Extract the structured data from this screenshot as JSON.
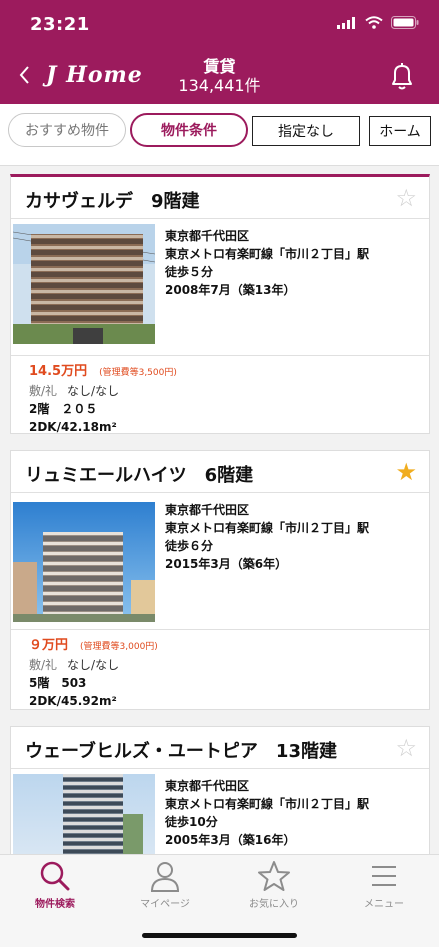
{
  "status": {
    "time": "23:21"
  },
  "header": {
    "logo": "J Home",
    "title": "賃貸",
    "count": "134,441件",
    "brand_color": "#9c1b5d"
  },
  "filters": {
    "recommend": "おすすめ物件",
    "conditions": "物件条件",
    "none": "指定なし",
    "home": "ホーム"
  },
  "listings": [
    {
      "name": "カサヴェルデ　9階建",
      "favorite": false,
      "ward": "東京都千代田区",
      "station": "東京メトロ有楽町線「市川２丁目」駅",
      "walk": "徒歩５分",
      "built": "2008年7月（築13年）",
      "price": "14.5万円",
      "management": "(管理費等3,500円)",
      "deposit_label": "敷/礼",
      "deposit_value": "なし/なし",
      "floor": "2階　２０５",
      "layout": "2DK/42.18m²"
    },
    {
      "name": "リュミエールハイツ　6階建",
      "favorite": true,
      "ward": "東京都千代田区",
      "station": "東京メトロ有楽町線「市川２丁目」駅",
      "walk": "徒歩６分",
      "built": "2015年3月（築6年）",
      "price": "９万円",
      "management": "(管理費等3,000円)",
      "deposit_label": "敷/礼",
      "deposit_value": "なし/なし",
      "floor": "5階　503",
      "layout": "2DK/45.92m²"
    },
    {
      "name": "ウェーブヒルズ・ユートピア　13階建",
      "favorite": false,
      "ward": "東京都千代田区",
      "station": "東京メトロ有楽町線「市川２丁目」駅",
      "walk": "徒歩10分",
      "built": "2005年3月（築16年）"
    }
  ],
  "tabs": [
    {
      "label": "物件検索",
      "icon": "search-icon",
      "active": true
    },
    {
      "label": "マイページ",
      "icon": "person-icon",
      "active": false
    },
    {
      "label": "お気に入り",
      "icon": "star-icon",
      "active": false
    },
    {
      "label": "メニュー",
      "icon": "menu-icon",
      "active": false
    }
  ]
}
